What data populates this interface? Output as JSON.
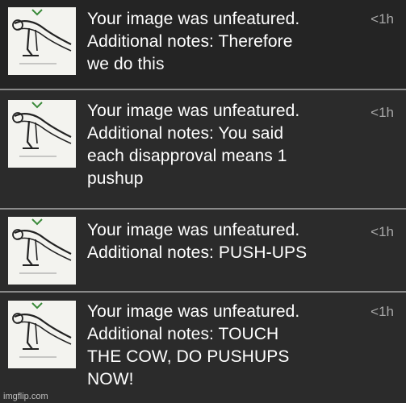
{
  "notifications": [
    {
      "thumbnail_icon": "pushup-figure-icon",
      "title": "Your image was unfeatured.",
      "note_lines": [
        "Additional notes: Therefore",
        "we do this"
      ],
      "time": "<1h"
    },
    {
      "thumbnail_icon": "pushup-figure-icon",
      "title": "Your image was unfeatured.",
      "note_lines": [
        "Additional notes: You said",
        "each disapproval means 1",
        "pushup"
      ],
      "time": "<1h"
    },
    {
      "thumbnail_icon": "pushup-figure-icon",
      "title": "Your image was unfeatured.",
      "note_lines": [
        "Additional notes: PUSH-UPS"
      ],
      "time": "<1h"
    },
    {
      "thumbnail_icon": "pushup-figure-icon",
      "title": "Your image was unfeatured.",
      "note_lines": [
        "Additional notes: TOUCH",
        "THE COW, DO PUSHUPS",
        "NOW!"
      ],
      "time": "<1h"
    }
  ],
  "watermark": "imgflip.com",
  "colors": {
    "row_background": "#2b2b2b",
    "divider": "#8a8a8a",
    "text": "#ffffff",
    "time_text": "#a9a9a9"
  }
}
